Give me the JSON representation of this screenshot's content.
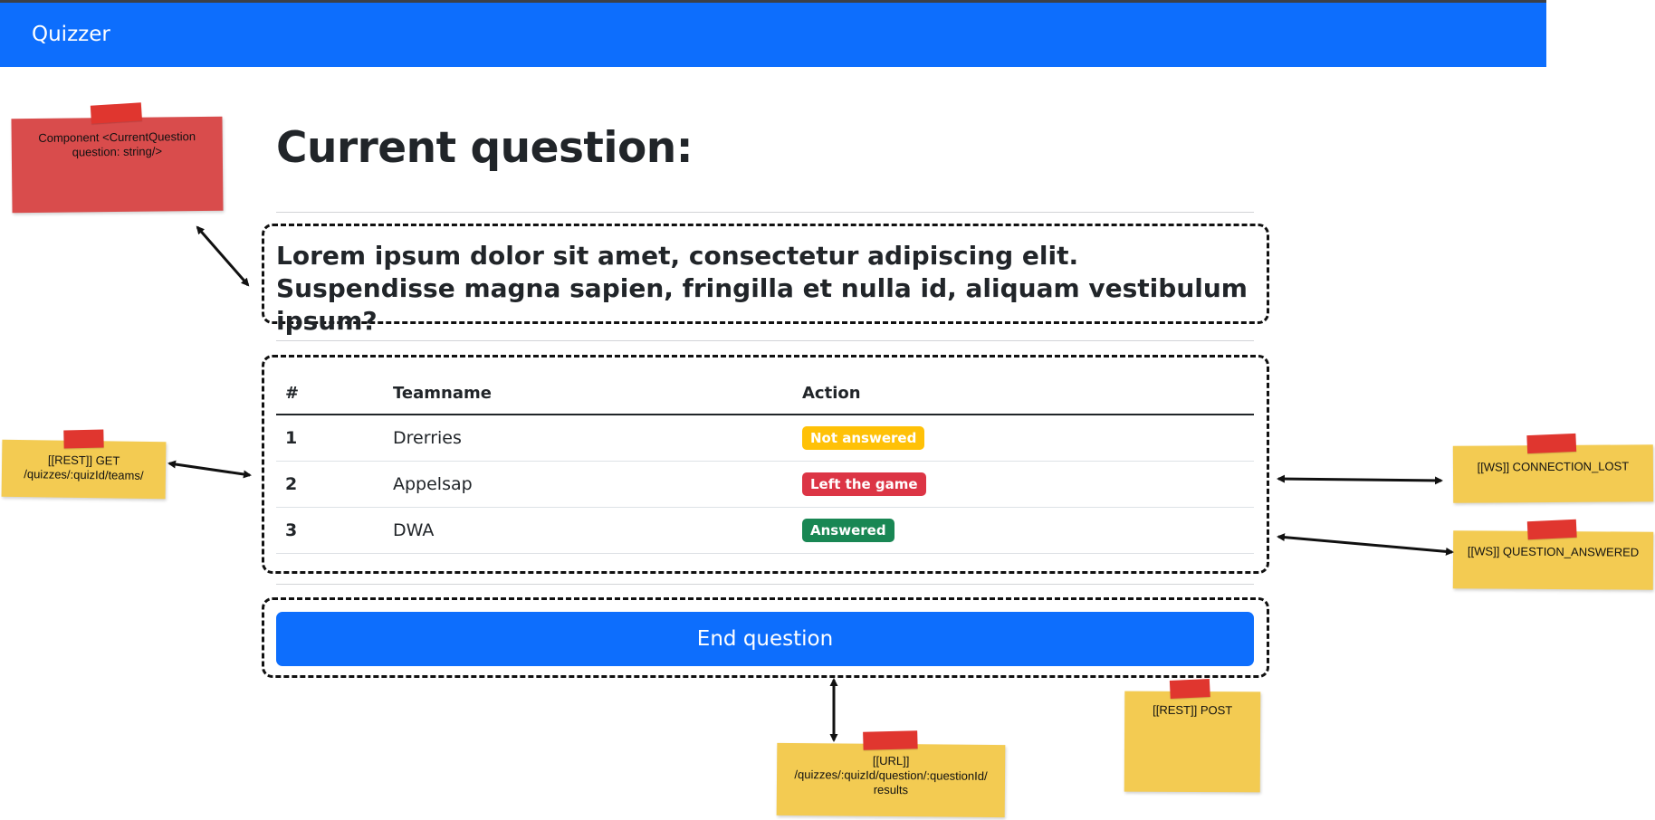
{
  "app": {
    "brand": "Quizzer"
  },
  "page": {
    "title": "Current question:",
    "question": "Lorem ipsum dolor sit amet, consectetur adipiscing elit. Suspendisse magna sapien, fringilla et nulla id, aliquam vestibulum ipsum?"
  },
  "table": {
    "headers": [
      "#",
      "Teamname",
      "Action"
    ],
    "rows": [
      {
        "num": "1",
        "team": "Drerries",
        "status": "Not answered",
        "status_color": "#ffc107"
      },
      {
        "num": "2",
        "team": "Appelsap",
        "status": "Left the game",
        "status_color": "#dc3545"
      },
      {
        "num": "3",
        "team": "DWA",
        "status": "Answered",
        "status_color": "#198754"
      }
    ]
  },
  "actions": {
    "end_question": "End question"
  },
  "notes": {
    "component": "Component <CurrentQuestion question: string/>",
    "rest_get": "[[REST]] GET /quizzes/:quizId/teams/",
    "ws_connection_lost": "[[WS]] CONNECTION_LOST",
    "ws_question_answered": "[[WS]] QUESTION_ANSWERED",
    "url_results": "[[URL]] /quizzes/:quizId/question/:questionId/ results",
    "rest_post": "[[REST]] POST"
  },
  "colors": {
    "primary": "#0d6efd",
    "note_yellow": "#f3cb52",
    "note_red": "#d94c4c",
    "tape": "#e0362f"
  }
}
